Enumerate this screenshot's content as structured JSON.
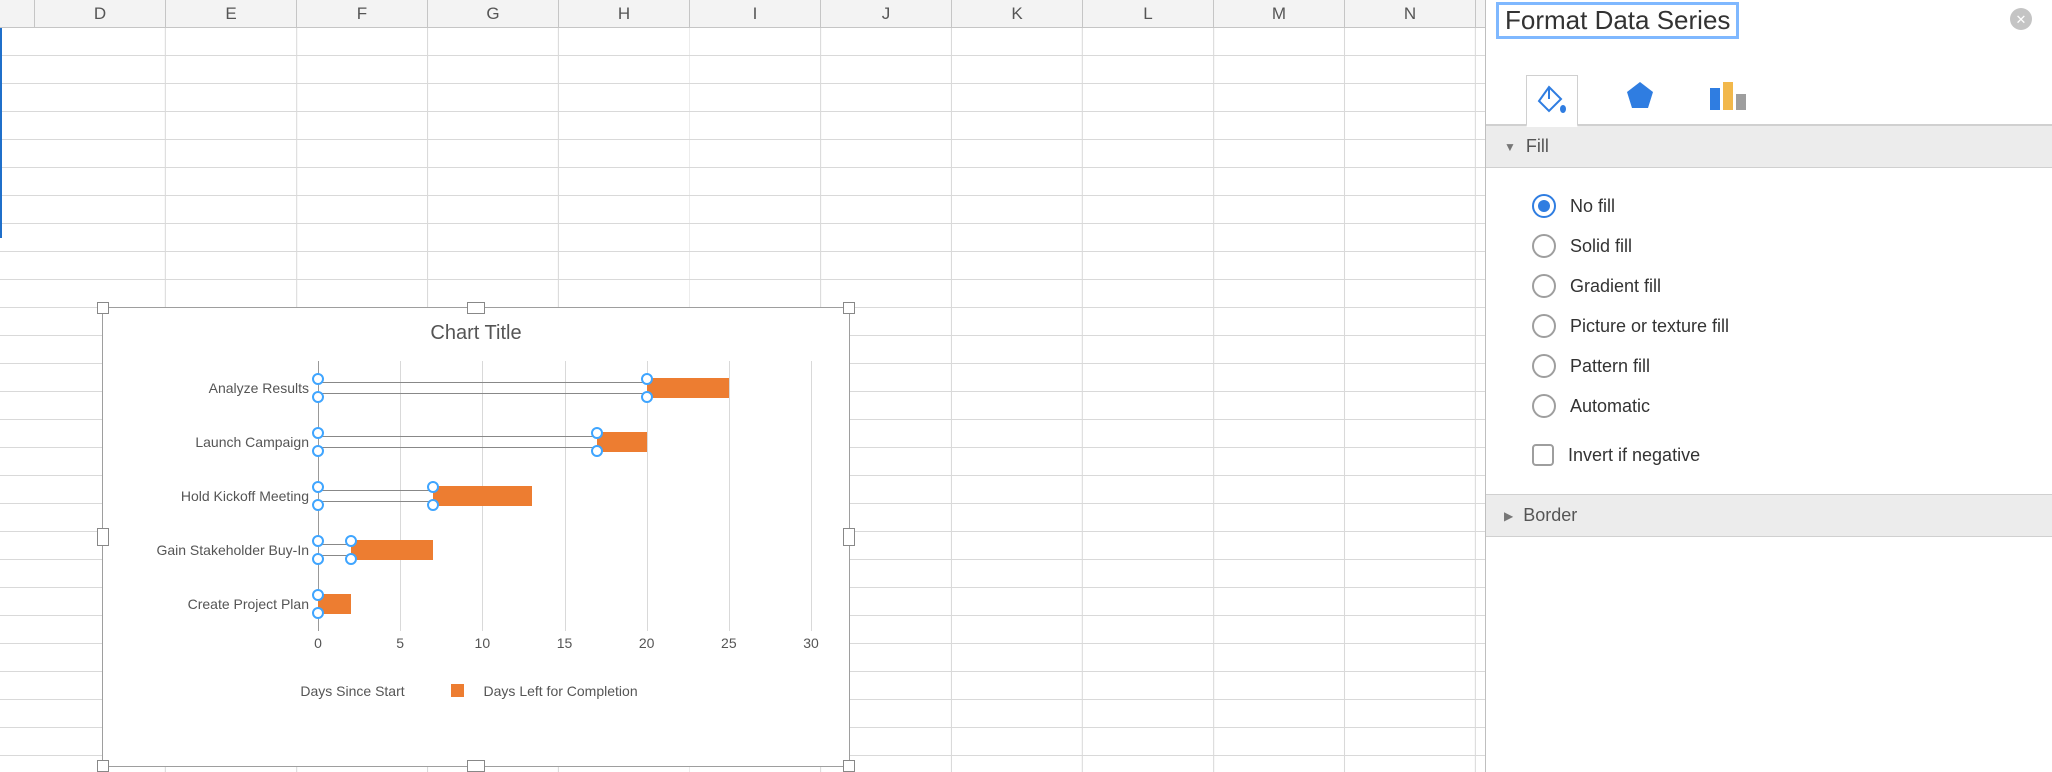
{
  "columns": [
    "D",
    "E",
    "F",
    "G",
    "H",
    "I",
    "J",
    "K",
    "L",
    "M",
    "N"
  ],
  "panel": {
    "title": "Format Data Series",
    "sections": {
      "fill": "Fill",
      "border": "Border"
    },
    "fill_options": {
      "no_fill": "No fill",
      "solid_fill": "Solid fill",
      "gradient_fill": "Gradient fill",
      "picture_fill": "Picture or texture fill",
      "pattern_fill": "Pattern fill",
      "automatic": "Automatic"
    },
    "fill_selected": "no_fill",
    "invert_if_negative": "Invert if negative"
  },
  "chart_data": {
    "type": "bar",
    "title": "Chart Title",
    "xlabel": "",
    "ylabel": "",
    "xlim": [
      0,
      30
    ],
    "ticks": [
      0,
      5,
      10,
      15,
      20,
      25,
      30
    ],
    "categories": [
      "Analyze Results",
      "Launch Campaign",
      "Hold Kickoff Meeting",
      "Gain Stakeholder Buy-In",
      "Create Project Plan"
    ],
    "series": [
      {
        "name": "Days Since Start",
        "values": [
          20,
          17,
          7,
          2,
          0
        ]
      },
      {
        "name": "Days Left for Completion",
        "values": [
          5,
          3,
          6,
          5,
          2
        ]
      }
    ],
    "selected_series_index": 0,
    "legend": {
      "s1": "Days Since Start",
      "s2": "Days Left for Completion"
    }
  }
}
